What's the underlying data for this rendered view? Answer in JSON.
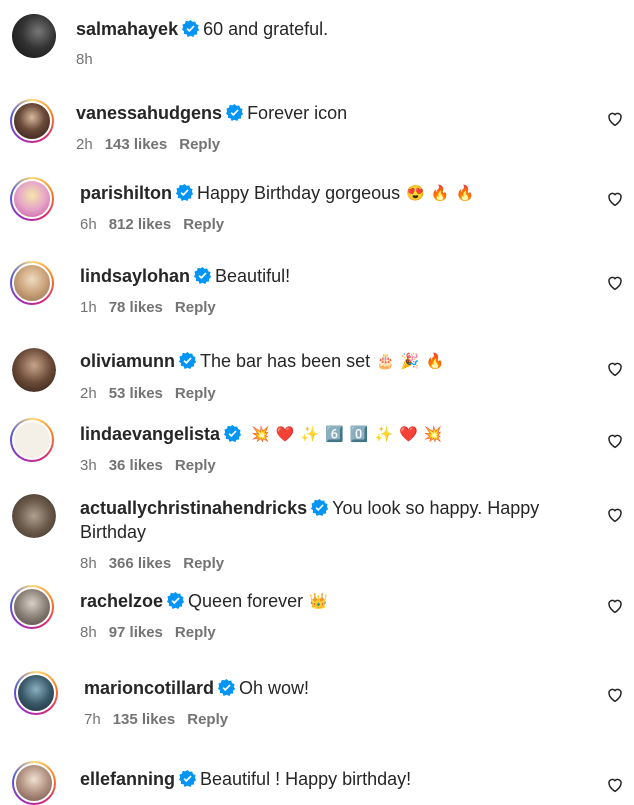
{
  "post": {
    "username": "salmahayek",
    "caption": "60 and grateful.",
    "time": "8h"
  },
  "comments": [
    {
      "username": "vanessahudgens",
      "text": "Forever icon",
      "time": "2h",
      "likes": "143 likes",
      "reply": "Reply"
    },
    {
      "username": "parishilton",
      "text": "Happy Birthday gorgeous",
      "emojis": [
        "😍",
        "🔥",
        "🔥"
      ],
      "time": "6h",
      "likes": "812 likes",
      "reply": "Reply"
    },
    {
      "username": "lindsaylohan",
      "text": "Beautiful!",
      "time": "1h",
      "likes": "78 likes",
      "reply": "Reply"
    },
    {
      "username": "oliviamunn",
      "text": "The bar has been set",
      "emojis": [
        "🎂",
        "🎉",
        "🔥"
      ],
      "time": "2h",
      "likes": "53 likes",
      "reply": "Reply"
    },
    {
      "username": "lindaevangelista",
      "text": "",
      "emojis": [
        "💥",
        "❤️",
        "✨",
        "6️⃣",
        "0️⃣",
        "✨",
        "❤️",
        "💥"
      ],
      "time": "3h",
      "likes": "36 likes",
      "reply": "Reply"
    },
    {
      "username": "actuallychristinahendricks",
      "text": "You look so happy. Happy Birthday",
      "time": "8h",
      "likes": "366 likes",
      "reply": "Reply"
    },
    {
      "username": "rachelzoe",
      "text": "Queen forever",
      "emojis": [
        "👑"
      ],
      "time": "8h",
      "likes": "97 likes",
      "reply": "Reply"
    },
    {
      "username": "marioncotillard",
      "text": "Oh wow!",
      "time": "7h",
      "likes": "135 likes",
      "reply": "Reply"
    },
    {
      "username": "ellefanning",
      "text": "Beautiful ! Happy birthday!",
      "time": "",
      "likes": "",
      "reply": ""
    }
  ],
  "colors": {
    "verified": "#0095f6",
    "muted": "#737373",
    "text": "#262626"
  }
}
